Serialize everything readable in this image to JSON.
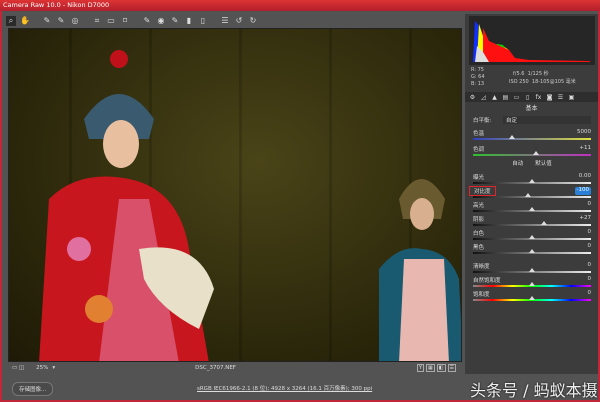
{
  "window": {
    "title": "Camera Raw 10.0 - Nikon D7000"
  },
  "toolbar": {
    "icons": [
      "zoom-icon",
      "hand-icon",
      "white-balance-icon",
      "color-sampler-icon",
      "targeted-adjustment-icon",
      "crop-icon",
      "straighten-icon",
      "transform-icon",
      "spot-removal-icon",
      "red-eye-icon",
      "adjustment-brush-icon",
      "graduated-filter-icon",
      "radial-filter-icon",
      "preferences-icon",
      "rotate-left-icon",
      "rotate-right-icon"
    ],
    "glyphs": [
      "⌕",
      "✋",
      "✎",
      "✎",
      "◎",
      "⌗",
      "▭",
      "⌑",
      "✎",
      "◉",
      "✎",
      "▮",
      "▯",
      "☰",
      "↺",
      "↻"
    ]
  },
  "image": {
    "zoom": "25%",
    "filename": "DSC_3707.NEF",
    "view_buttons": [
      "Y",
      "▦",
      "◧",
      "☰"
    ]
  },
  "histogram": {
    "colors": [
      "#1030ff",
      "#ffff00",
      "#00ff00",
      "#ff0000"
    ]
  },
  "info": {
    "r_label": "R:",
    "r": "75",
    "g_label": "G:",
    "g": "64",
    "b_label": "B:",
    "b": "13",
    "aperture": "f/5.6",
    "shutter": "1/125 秒",
    "iso": "ISO 250",
    "lens": "18-105@105 毫米"
  },
  "panel": {
    "section_title": "基本",
    "white_balance_label": "白平衡:",
    "white_balance_value": "自定",
    "auto": "自动",
    "default": "默认值",
    "sliders": [
      {
        "label": "色温",
        "value": "5000",
        "position": 0.33,
        "track": "temp"
      },
      {
        "label": "色调",
        "value": "+11",
        "position": 0.53,
        "track": "tint"
      },
      {
        "label": "曝光",
        "value": "0.00",
        "position": 0.5,
        "track": "gray"
      },
      {
        "label": "对比度",
        "value": "-100",
        "position": 0.47,
        "track": "gray",
        "highlight": true
      },
      {
        "label": "高光",
        "value": "0",
        "position": 0.5,
        "track": "gray"
      },
      {
        "label": "阴影",
        "value": "+27",
        "position": 0.6,
        "track": "gray"
      },
      {
        "label": "白色",
        "value": "0",
        "position": 0.5,
        "track": "gray"
      },
      {
        "label": "黑色",
        "value": "0",
        "position": 0.5,
        "track": "gray"
      },
      {
        "label": "清晰度",
        "value": "0",
        "position": 0.5,
        "track": "gray"
      },
      {
        "label": "自然饱和度",
        "value": "0",
        "position": 0.5,
        "track": "sat"
      },
      {
        "label": "饱和度",
        "value": "0",
        "position": 0.5,
        "track": "sat"
      }
    ],
    "highlight_color": "#e0242c",
    "value_highlight": "#2a7fd6"
  },
  "bottom": {
    "save_button": "存储图像...",
    "workflow_link": "sRGB IEC61966-2.1 (8 位); 4928 x 3264 (16.1 百万像素); 300 ppi",
    "watermark": "头条号 / 蚂蚁本摄"
  }
}
